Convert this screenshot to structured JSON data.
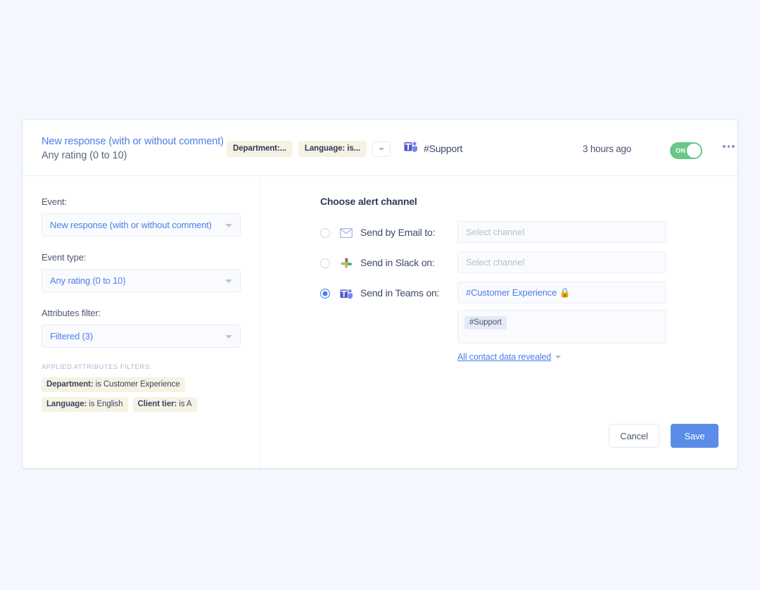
{
  "header": {
    "title": "New response (with or without comment)",
    "subtitle": "Any rating (0 to 10)",
    "chips": [
      {
        "label": "Department:..."
      },
      {
        "label": "Language: is..."
      }
    ],
    "more_chips_icon": "chevron-down-icon",
    "channel_icon": "microsoft-teams-icon",
    "channel_name": "#Support",
    "timestamp": "3 hours ago",
    "toggle": {
      "state_label": "ON",
      "on": true,
      "color": "#68c886"
    },
    "overflow_icon": "kebab-menu-icon"
  },
  "left_panel": {
    "event": {
      "label": "Event:",
      "value": "New response (with or without comment)"
    },
    "event_type": {
      "label": "Event type:",
      "value": "Any rating (0 to 10)"
    },
    "attributes_filter": {
      "label": "Attributes filter:",
      "value": "Filtered (3)"
    },
    "applied_title": "APPLIED ATTRIBUTES FILTERS:",
    "applied_tags": [
      {
        "key": "Department:",
        "value": "is Customer Experience"
      },
      {
        "key": "Language:",
        "value": "is English"
      },
      {
        "key": "Client tier:",
        "value": "is A"
      }
    ]
  },
  "right_panel": {
    "section_title": "Choose alert channel",
    "channels": [
      {
        "id": "email",
        "icon": "envelope-icon",
        "label": "Send by Email to:",
        "selected": false,
        "select_placeholder": "Select channel",
        "select_value": "",
        "has_refresh": false
      },
      {
        "id": "slack",
        "icon": "slack-icon",
        "label": "Send in Slack on:",
        "selected": false,
        "select_placeholder": "Select channel",
        "select_value": "",
        "has_refresh": true
      },
      {
        "id": "teams",
        "icon": "microsoft-teams-icon",
        "label": "Send in Teams on:",
        "selected": true,
        "select_placeholder": "",
        "select_value": "#Customer Experience 🔒",
        "has_refresh": true
      }
    ],
    "teams_tagbox": {
      "tags": [
        "#Support"
      ]
    },
    "reveal_link": {
      "text": "All contact data revealed",
      "caret_icon": "caret-down-icon"
    }
  },
  "footer": {
    "cancel_label": "Cancel",
    "save_label": "Save",
    "save_color": "#5a8ce8"
  }
}
